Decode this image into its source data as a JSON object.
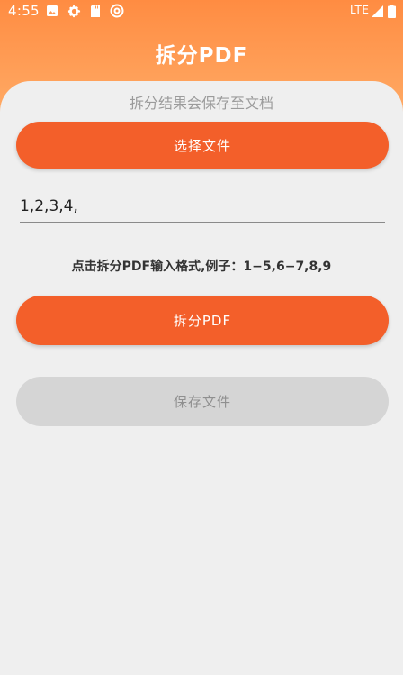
{
  "status_bar": {
    "time": "4:55",
    "network": "LTE",
    "icons": [
      "image-icon",
      "gear-icon",
      "sd-card-icon",
      "sync-icon",
      "signal-icon",
      "battery-icon"
    ]
  },
  "app": {
    "title": "拆分PDF",
    "subtitle": "拆分结果会保存至文档"
  },
  "actions": {
    "select_file_label": "选择文件",
    "split_label": "拆分PDF",
    "save_label": "保存文件"
  },
  "page_input": {
    "value": "1,2,3,4,",
    "placeholder": ""
  },
  "hint": "点击拆分PDF输入格式,例子：1−5,6−7,8,9",
  "colors": {
    "header_start": "#ff8c42",
    "header_end": "#ffab66",
    "primary_button": "#f35f2a",
    "disabled_button": "#d5d5d5",
    "background": "#efefef"
  }
}
